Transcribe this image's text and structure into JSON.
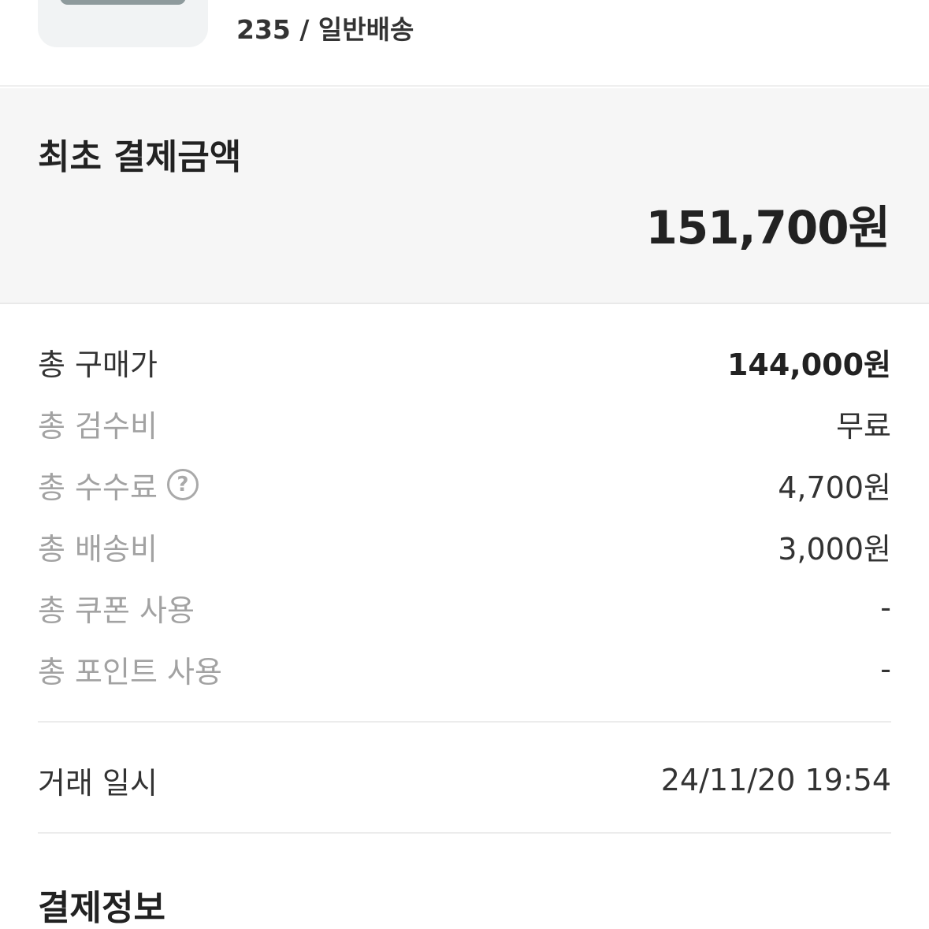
{
  "product": {
    "thumbnail_icon": "product-shoe-image",
    "option": "235 / 일반배송"
  },
  "initial_payment": {
    "title": "최초 결제금액",
    "amount": "151,700원"
  },
  "breakdown": [
    {
      "label": "총 구매가",
      "value": "144,000원"
    },
    {
      "label": "총 검수비",
      "value": "무료"
    },
    {
      "label": "총 수수료",
      "value": "4,700원",
      "help_icon": "?"
    },
    {
      "label": "총 배송비",
      "value": "3,000원"
    },
    {
      "label": "총 쿠폰 사용",
      "value": "-"
    },
    {
      "label": "총 포인트 사용",
      "value": "-"
    }
  ],
  "transaction": {
    "label": "거래 일시",
    "value": "24/11/20 19:54"
  },
  "payment_info": {
    "title": "결제정보"
  }
}
